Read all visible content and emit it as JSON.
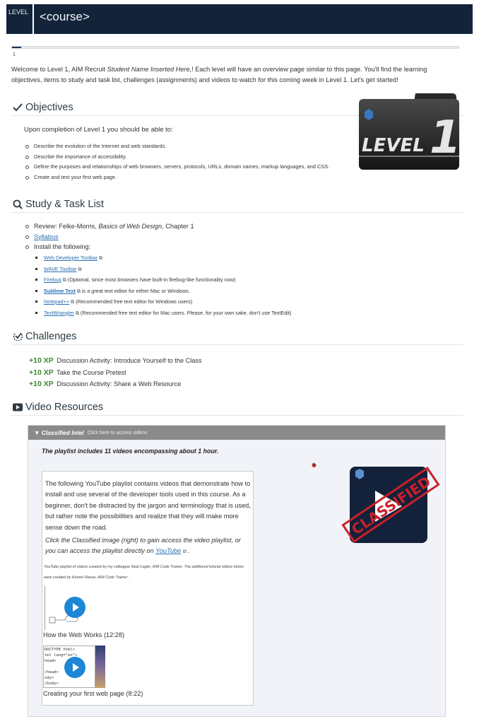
{
  "header": {
    "level_label": "LEVEL",
    "course_title": "<course>"
  },
  "progress": {
    "percent": 2,
    "page": "1"
  },
  "intro": {
    "before": "Welcome to Level 1, AIM Recruit ",
    "student_name": "Student Name Inserted Here,",
    "after": "! Each level will have an overview page similar to this page. You'll find the learning objectives, items to study and task list, challenges (assignments) and videos to watch for this coming week in Level 1. Let's get started!"
  },
  "objectives": {
    "title": "Objectives",
    "icon": "checkmark-icon",
    "lead": "Upon completion of Level 1 you should be able to:",
    "items": [
      "Describe the evolution of the Internet and web standards.",
      "Describe the importance of accessibility.",
      "Define the purposes and relationships of web browsers, servers, protocols, URLs, domain names, markup languages, and CSS.",
      "Create and test your first web page."
    ],
    "image_text": {
      "word": "LEVEL",
      "number": "1"
    }
  },
  "study": {
    "title": "Study & Task List",
    "icon": "search-icon",
    "review": {
      "prefix": "Review: Felke-Morris, ",
      "book": "Basics of Web Design",
      "suffix": ", Chapter 1"
    },
    "syllabus_link": "Syllabus",
    "install_label": "Install the following:",
    "tools": [
      {
        "name": "Web Developer Toolbar",
        "note": ""
      },
      {
        "name": "WAVE Toolbar",
        "note": ""
      },
      {
        "name": "Firebug",
        "note": "(Optional, since most browsers have built-in firebug-like functionality now)"
      },
      {
        "name": "Sublime Text",
        "note": "is a great text editor for either Mac or Windows."
      },
      {
        "name": "Notepad++",
        "note": "(Recommended free text editor for Windows users)"
      },
      {
        "name": "TextWrangler",
        "note": "(Recommended free text editor for Mac users. Please, for your own sake, don't use TextEdit)"
      }
    ],
    "external_icon": "⧉"
  },
  "challenges": {
    "title": "Challenges",
    "icon": "challenge-icon",
    "items": [
      {
        "xp": "+10 XP",
        "label": "Discussion Activity: Introduce Yourself to the Class"
      },
      {
        "xp": "+10 XP",
        "label": "Take the Course Pretest"
      },
      {
        "xp": "+10 XP",
        "label": "Discussion Activity: Share a Web Resource"
      }
    ]
  },
  "videos": {
    "title": "Video Resources",
    "icon": "video-icon",
    "bar_title": "▼ Classified Intel",
    "bar_subtitle": "Click here to access videos",
    "summary": "The playlist includes 11 videos encompassing about 1 hour.",
    "paragraph": "The following YouTube playlist contains videos that demonstrate how to install and use several of the developer tools used in this course. As a beginner, don't be distracted by the jargon and terminology that is used, but rather note the possibilities and realize that they will make more sense down the road.",
    "instruction": "Click the Classified image (right) to gain access the video playlist, or you can access the playlist directly on ",
    "youtube_link": "YouTube",
    "credit": "YouTube playlist of videos created by my colleague Neal Legler, AIM Code Trainer. The additional tutorial videos below were created by Kevein Reeve, AIM Code Trainer .",
    "clips": [
      {
        "title": "How the Web Works (12:28)"
      },
      {
        "title": "Creating your first web page (8:22)"
      }
    ],
    "stamp_text": "CLASSIFIED",
    "colors": {
      "stamp": "#c9202a",
      "play": "#1d86d6",
      "xp": "#3a8a2e",
      "header": "#13243a"
    }
  }
}
